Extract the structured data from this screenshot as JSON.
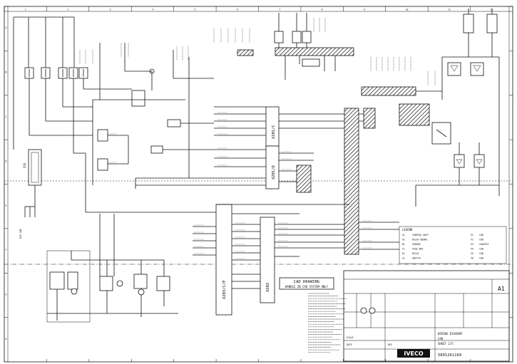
{
  "sheet": {
    "col_markers_top": [
      "1",
      "2",
      "3",
      "4",
      "5",
      "6",
      "7",
      "8",
      "9",
      "10",
      "11",
      "12"
    ],
    "row_markers_left": [
      "A",
      "B",
      "C",
      "D",
      "E",
      "F",
      "G",
      "H"
    ]
  },
  "stamp": {
    "line1": "CAD DRAWING",
    "line2": "HANDLE IN CAD SYSTEM ONLY"
  },
  "connectors": {
    "vertical_a": "X201/C",
    "vertical_b": "X201/D",
    "vertical_c": "X202",
    "horizontal_a": "X203/C/P",
    "left_connector": "X10",
    "mid_connector": "X205",
    "right_block": "X1"
  },
  "title_block": {
    "brand": "IVECO",
    "sheet_id": "A1",
    "drawing_number": "5801261169",
    "title_line1": "WIRING DIAGRAM",
    "title_line2": "CAB",
    "title_line3": "SHEET 2/5",
    "scale_label": "SCALE",
    "date_label": "DATE",
    "rev_label": "REV"
  },
  "legend": {
    "header": "LEGEND",
    "rows": [
      {
        "code": "A1",
        "text": "CONTROL UNIT",
        "ref": "V1",
        "side": "CAB"
      },
      {
        "code": "A2",
        "text": "RELAY BOARD",
        "ref": "V2",
        "side": "CAB"
      },
      {
        "code": "B1",
        "text": "SENSOR",
        "ref": "V3",
        "side": "CHASSIS"
      },
      {
        "code": "F1",
        "text": "FUSE BOX",
        "ref": "V4",
        "side": "CAB"
      },
      {
        "code": "K1",
        "text": "RELAY",
        "ref": "V5",
        "side": "CAB"
      },
      {
        "code": "S1",
        "text": "SWITCH",
        "ref": "V6",
        "side": "CAB"
      }
    ]
  }
}
